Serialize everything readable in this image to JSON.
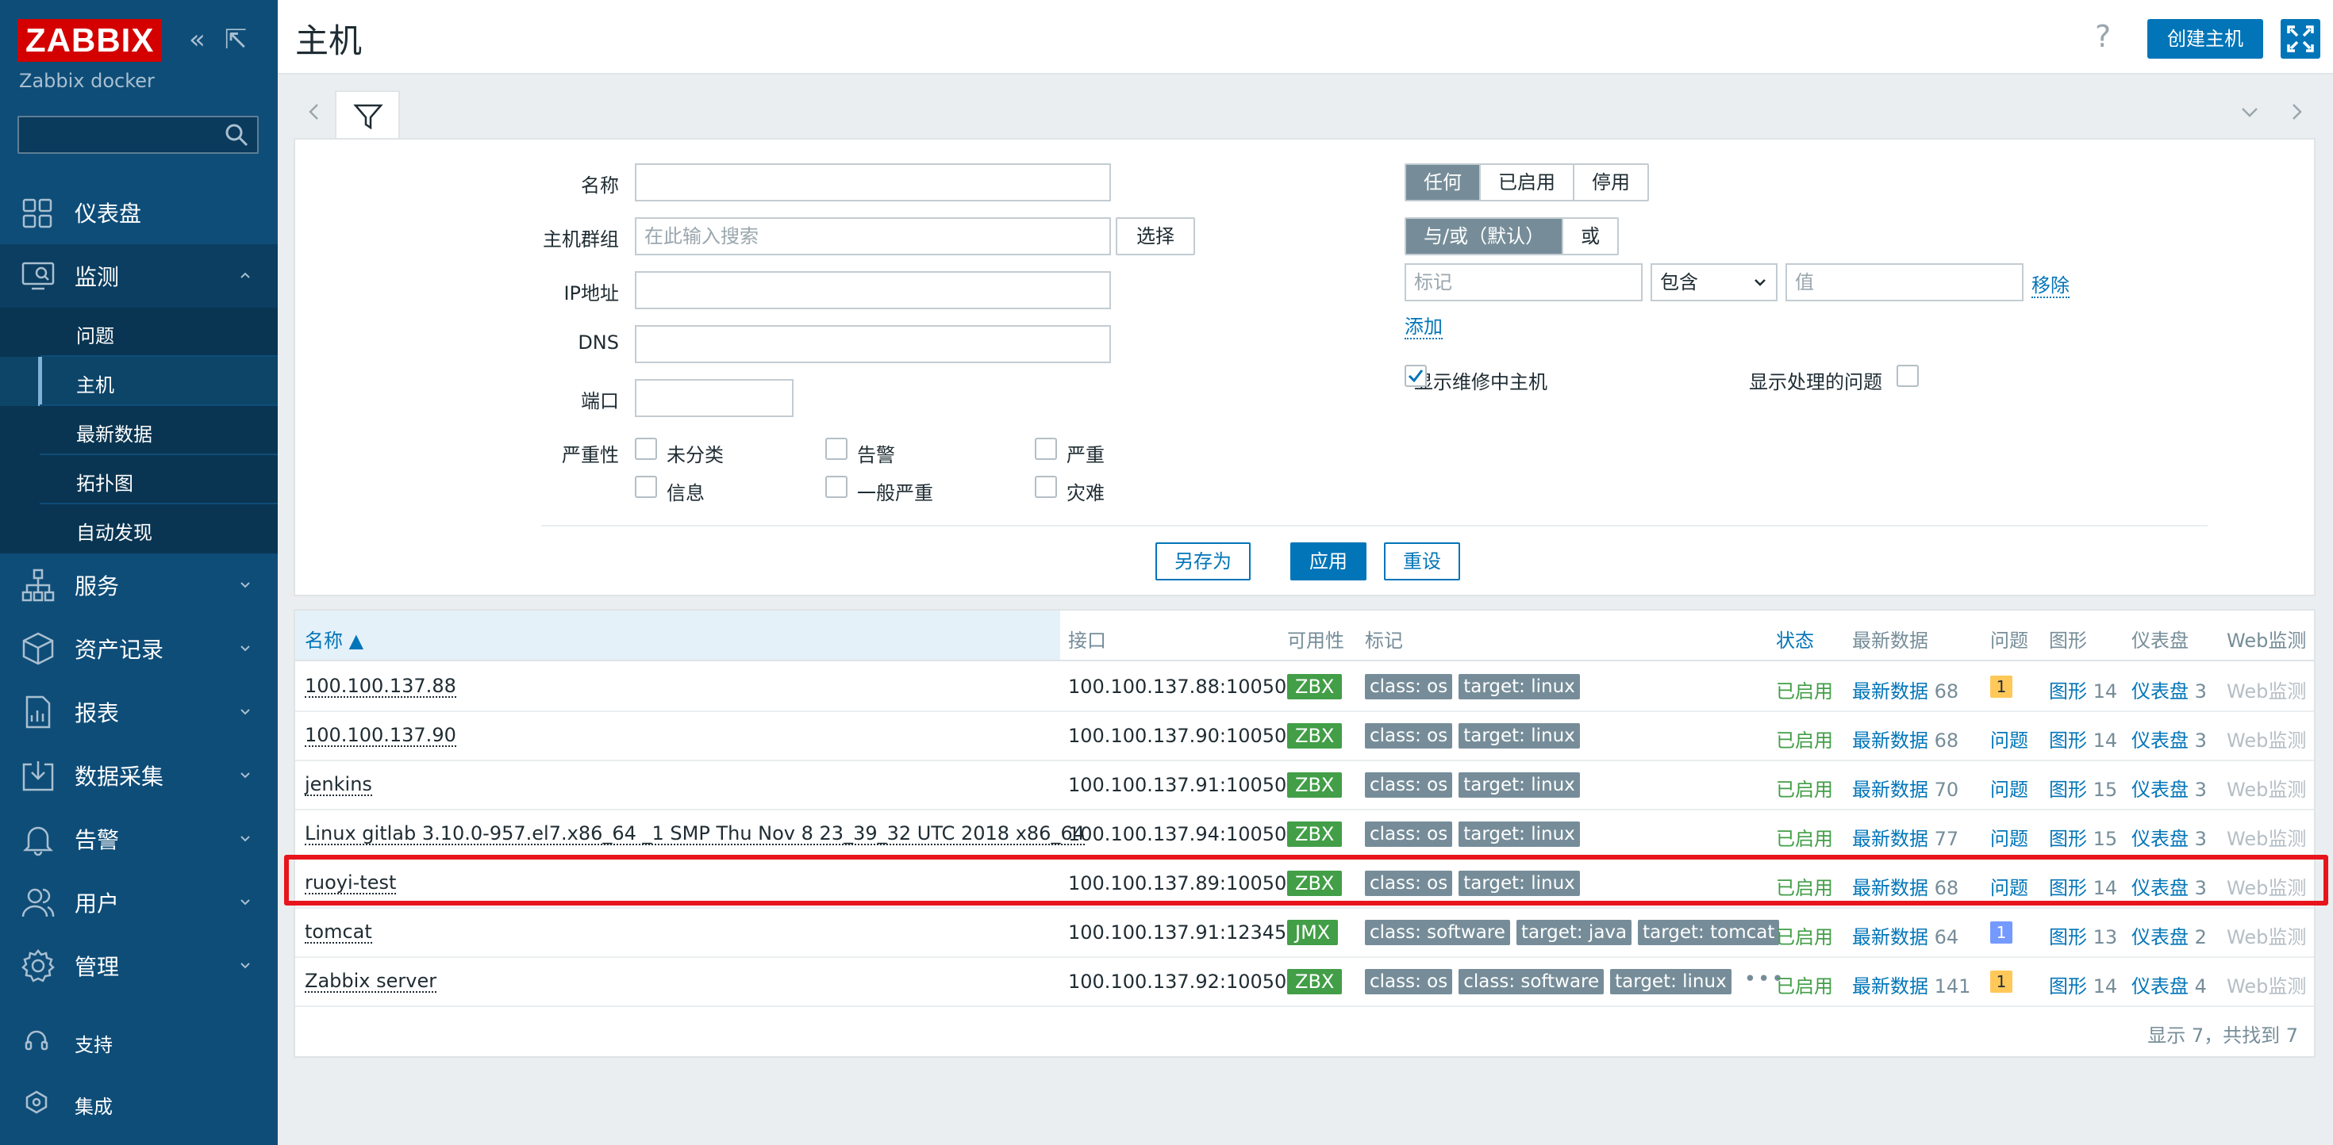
{
  "sidebar": {
    "logo": "ZABBIX",
    "server_name": "Zabbix docker",
    "search_placeholder": "",
    "menu": [
      {
        "label": "仪表盘",
        "icon": "dashboard-icon"
      },
      {
        "label": "监测",
        "icon": "monitoring-icon"
      },
      {
        "label": "服务",
        "icon": "services-icon"
      },
      {
        "label": "资产记录",
        "icon": "inventory-icon"
      },
      {
        "label": "报表",
        "icon": "reports-icon"
      },
      {
        "label": "数据采集",
        "icon": "data-collection-icon"
      },
      {
        "label": "告警",
        "icon": "alerts-icon"
      },
      {
        "label": "用户",
        "icon": "users-icon"
      },
      {
        "label": "管理",
        "icon": "administration-icon"
      }
    ],
    "submenu": [
      "问题",
      "主机",
      "最新数据",
      "拓扑图",
      "自动发现"
    ],
    "support": "支持",
    "integrations": "集成"
  },
  "header": {
    "title": "主机",
    "help": "?",
    "create_button": "创建主机"
  },
  "filter": {
    "name_label": "名称",
    "name_value": "",
    "hostgroup_label": "主机群组",
    "hostgroup_placeholder": "在此输入搜索",
    "select_button": "选择",
    "ip_label": "IP地址",
    "dns_label": "DNS",
    "port_label": "端口",
    "severity_label": "严重性",
    "severities": [
      "未分类",
      "告警",
      "严重",
      "信息",
      "一般严重",
      "灾难"
    ],
    "status_label": "状态",
    "status_options": [
      "任何",
      "已启用",
      "停用"
    ],
    "status_selected": "任何",
    "tags_label": "标记",
    "tags_options": [
      "与/或（默认）",
      "或"
    ],
    "tag_placeholder": "标记",
    "tag_operator": "包含",
    "tag_value_placeholder": "值",
    "remove_link": "移除",
    "add_link": "添加",
    "maintenance_label": "显示维修中主机",
    "maintenance_checked": true,
    "suppressed_label": "显示处理的问题",
    "suppressed_checked": false,
    "save_as_button": "另存为",
    "apply_button": "应用",
    "reset_button": "重设"
  },
  "table": {
    "columns": [
      "名称 ▲",
      "接口",
      "可用性",
      "标记",
      "状态",
      "最新数据",
      "问题",
      "图形",
      "仪表盘",
      "Web监测"
    ],
    "rows": [
      {
        "name": "100.100.137.88",
        "interface": "100.100.137.88:10050",
        "availability": "ZBX",
        "tags": [
          "class: os",
          "target: linux"
        ],
        "status": "已启用",
        "latest": "最新数据",
        "latest_count": "68",
        "problems": "1",
        "problems_kind": "warn",
        "graphs": "图形",
        "graphs_count": "14",
        "dashboards": "仪表盘",
        "dashboards_count": "3",
        "web": "Web监测"
      },
      {
        "name": "100.100.137.90",
        "interface": "100.100.137.90:10050",
        "availability": "ZBX",
        "tags": [
          "class: os",
          "target: linux"
        ],
        "status": "已启用",
        "latest": "最新数据",
        "latest_count": "68",
        "problems": "问题",
        "problems_kind": "link",
        "graphs": "图形",
        "graphs_count": "14",
        "dashboards": "仪表盘",
        "dashboards_count": "3",
        "web": "Web监测"
      },
      {
        "name": "jenkins",
        "interface": "100.100.137.91:10050",
        "availability": "ZBX",
        "tags": [
          "class: os",
          "target: linux"
        ],
        "status": "已启用",
        "latest": "最新数据",
        "latest_count": "70",
        "problems": "问题",
        "problems_kind": "link",
        "graphs": "图形",
        "graphs_count": "15",
        "dashboards": "仪表盘",
        "dashboards_count": "3",
        "web": "Web监测"
      },
      {
        "name": "Linux gitlab 3.10.0-957.el7.x86_64 _1 SMP Thu Nov 8 23_39_32 UTC 2018 x86_64",
        "interface": "100.100.137.94:10050",
        "availability": "ZBX",
        "tags": [
          "class: os",
          "target: linux"
        ],
        "status": "已启用",
        "latest": "最新数据",
        "latest_count": "77",
        "problems": "问题",
        "problems_kind": "link",
        "graphs": "图形",
        "graphs_count": "15",
        "dashboards": "仪表盘",
        "dashboards_count": "3",
        "web": "Web监测"
      },
      {
        "name": "ruoyi-test",
        "interface": "100.100.137.89:10050",
        "availability": "ZBX",
        "tags": [
          "class: os",
          "target: linux"
        ],
        "status": "已启用",
        "latest": "最新数据",
        "latest_count": "68",
        "problems": "问题",
        "problems_kind": "link",
        "graphs": "图形",
        "graphs_count": "14",
        "dashboards": "仪表盘",
        "dashboards_count": "3",
        "web": "Web监测"
      },
      {
        "name": "tomcat",
        "interface": "100.100.137.91:12345",
        "availability": "JMX",
        "tags": [
          "class: software",
          "target: java",
          "target: tomcat"
        ],
        "status": "已启用",
        "latest": "最新数据",
        "latest_count": "64",
        "problems": "1",
        "problems_kind": "info",
        "graphs": "图形",
        "graphs_count": "13",
        "dashboards": "仪表盘",
        "dashboards_count": "2",
        "web": "Web监测"
      },
      {
        "name": "Zabbix server",
        "interface": "100.100.137.92:10050",
        "availability": "ZBX",
        "tags": [
          "class: os",
          "class: software",
          "target: linux"
        ],
        "more_tags": "•••",
        "status": "已启用",
        "latest": "最新数据",
        "latest_count": "141",
        "problems": "1",
        "problems_kind": "warn",
        "graphs": "图形",
        "graphs_count": "14",
        "dashboards": "仪表盘",
        "dashboards_count": "4",
        "web": "Web监测"
      }
    ],
    "footer": "显示 7，共找到 7"
  },
  "colors": {
    "sidebar_bg": "#0e4d78",
    "accent": "#0275b8",
    "enabled": "#429e47",
    "highlight": "#e8141b",
    "warning": "#ffc859",
    "information": "#7499ff"
  }
}
